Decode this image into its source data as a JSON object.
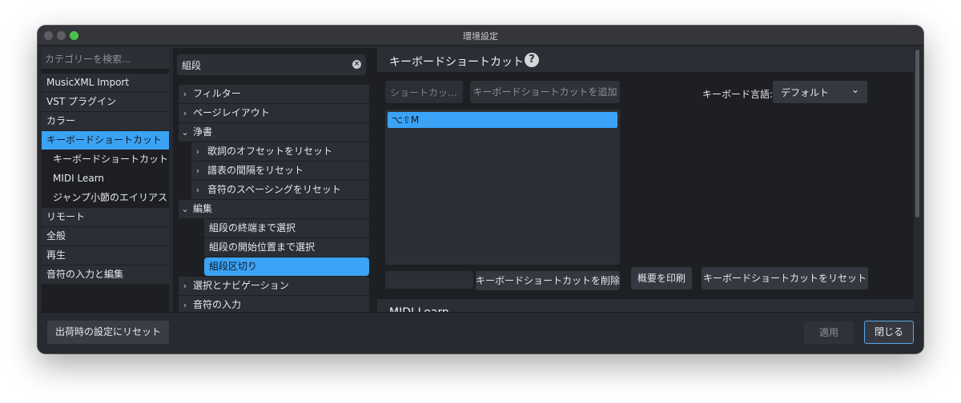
{
  "window": {
    "title": "環境設定"
  },
  "categories": {
    "search_placeholder": "カテゴリーを検索...",
    "items": [
      {
        "label": "MusicXML Import"
      },
      {
        "label": "VST プラグイン"
      },
      {
        "label": "カラー"
      },
      {
        "label": "キーボードショートカット",
        "selected": true
      },
      {
        "label": "キーボードショートカット",
        "sub": true
      },
      {
        "label": "MIDI Learn",
        "sub": true
      },
      {
        "label": "ジャンプ小節のエイリアス",
        "sub": true
      },
      {
        "label": "リモート"
      },
      {
        "label": "全般"
      },
      {
        "label": "再生"
      },
      {
        "label": "音符の入力と編集"
      }
    ]
  },
  "tree": {
    "search_value": "組段",
    "clear_glyph": "×",
    "items": [
      {
        "label": "フィルター",
        "chevron": "›",
        "level": "l0"
      },
      {
        "label": "ページレイアウト",
        "chevron": "›",
        "level": "l0"
      },
      {
        "label": "浄書",
        "chevron": "⌄",
        "level": "l0"
      },
      {
        "label": "歌詞のオフセットをリセット",
        "chevron": "›",
        "level": "l1"
      },
      {
        "label": "譜表の間隔をリセット",
        "chevron": "›",
        "level": "l1"
      },
      {
        "label": "音符のスペーシングをリセット",
        "chevron": "›",
        "level": "l1"
      },
      {
        "label": "編集",
        "chevron": "⌄",
        "level": "l0"
      },
      {
        "label": "組段の終端まで選択",
        "chevron": "",
        "level": "leaf"
      },
      {
        "label": "組段の開始位置まで選択",
        "chevron": "",
        "level": "leaf"
      },
      {
        "label": "組段区切り",
        "chevron": "",
        "level": "leaf",
        "selected": true
      },
      {
        "label": "選択とナビゲーション",
        "chevron": "›",
        "level": "l0"
      },
      {
        "label": "音符の入力",
        "chevron": "›",
        "level": "l0"
      }
    ]
  },
  "main": {
    "section_title": "キーボードショートカット",
    "help_glyph": "?",
    "shortcut_field_placeholder": "ショートカッ…",
    "add_button": "キーボードショートカットを追加",
    "language_label": "キーボード言語:",
    "language_value": "デフォルト",
    "language_chevron": "⌄",
    "shortcuts": [
      "⌥⇧M"
    ],
    "delete_button": "キーボードショートカットを削除",
    "print_button": "概要を印刷",
    "reset_button": "キーボードショートカットをリセット",
    "midi_section_title": "MIDI Learn"
  },
  "footer": {
    "factory_reset": "出荷時の設定にリセット",
    "apply": "適用",
    "close": "閉じる"
  }
}
